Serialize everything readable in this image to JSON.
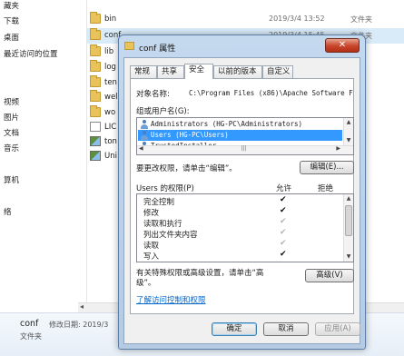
{
  "explorer": {
    "nav_items": [
      "藏夹",
      "下载",
      "桌面",
      "最近访问的位置",
      "视频",
      "图片",
      "文档",
      "音乐",
      "算机",
      "络"
    ],
    "files": [
      {
        "name": "bin",
        "date": "2019/3/4 13:52",
        "type": "文件夹",
        "icon": "folder-icon"
      },
      {
        "name": "conf",
        "date": "2019/3/4 15:45",
        "type": "文件夹",
        "icon": "folder-icon"
      },
      {
        "name": "lib",
        "date": "",
        "type": "",
        "icon": "folder-icon"
      },
      {
        "name": "log",
        "date": "",
        "type": "",
        "icon": "folder-icon"
      },
      {
        "name": "ten",
        "date": "",
        "type": "",
        "icon": "folder-icon"
      },
      {
        "name": "wel",
        "date": "",
        "type": "",
        "icon": "folder-icon"
      },
      {
        "name": "wo",
        "date": "",
        "type": "",
        "icon": "folder-icon"
      },
      {
        "name": "LIC",
        "date": "",
        "type": "",
        "icon": "doc-icon"
      },
      {
        "name": "ton",
        "date": "",
        "type": "",
        "icon": "image-file-icon"
      },
      {
        "name": "Uni",
        "date": "",
        "type": "序",
        "icon": "image-file-icon"
      }
    ],
    "details": {
      "name": "conf",
      "meta": "修改日期: 2019/3",
      "type": "文件夹"
    }
  },
  "dialog": {
    "title": "conf 属性",
    "close_label": "✕",
    "tabs": [
      "常规",
      "共享",
      "安全",
      "以前的版本",
      "自定义"
    ],
    "active_tab": "安全",
    "object_name_label": "对象名称:",
    "object_name_value": "C:\\Program Files (x86)\\Apache Software F",
    "group_label": "组或用户名(G):",
    "groups": [
      {
        "name": "Administrators (HG-PC\\Administrators)",
        "selected": false
      },
      {
        "name": "Users (HG-PC\\Users)",
        "selected": true
      },
      {
        "name": "TrustedInstaller",
        "selected": false
      }
    ],
    "edit_hint": "要更改权限，请单击“编辑”。",
    "edit_button": "编辑(E)...",
    "permissions_label": "Users 的权限(P)",
    "allow_header": "允许",
    "deny_header": "拒绝",
    "permissions": [
      {
        "name": "完全控制",
        "allow": "✔",
        "allow_inherited": false
      },
      {
        "name": "修改",
        "allow": "✔",
        "allow_inherited": false
      },
      {
        "name": "读取和执行",
        "allow": "✔",
        "allow_inherited": true
      },
      {
        "name": "列出文件夹内容",
        "allow": "✔",
        "allow_inherited": true
      },
      {
        "name": "读取",
        "allow": "✔",
        "allow_inherited": true
      },
      {
        "name": "写入",
        "allow": "✔",
        "allow_inherited": false
      }
    ],
    "advanced_hint_line1": "有关特殊权限或高级设置，请单击“高",
    "advanced_hint_line2": "级”。",
    "advanced_button": "高级(V)",
    "access_link": "了解访问控制和权限",
    "ok_button": "确定",
    "cancel_button": "取消",
    "apply_button": "应用(A)"
  }
}
